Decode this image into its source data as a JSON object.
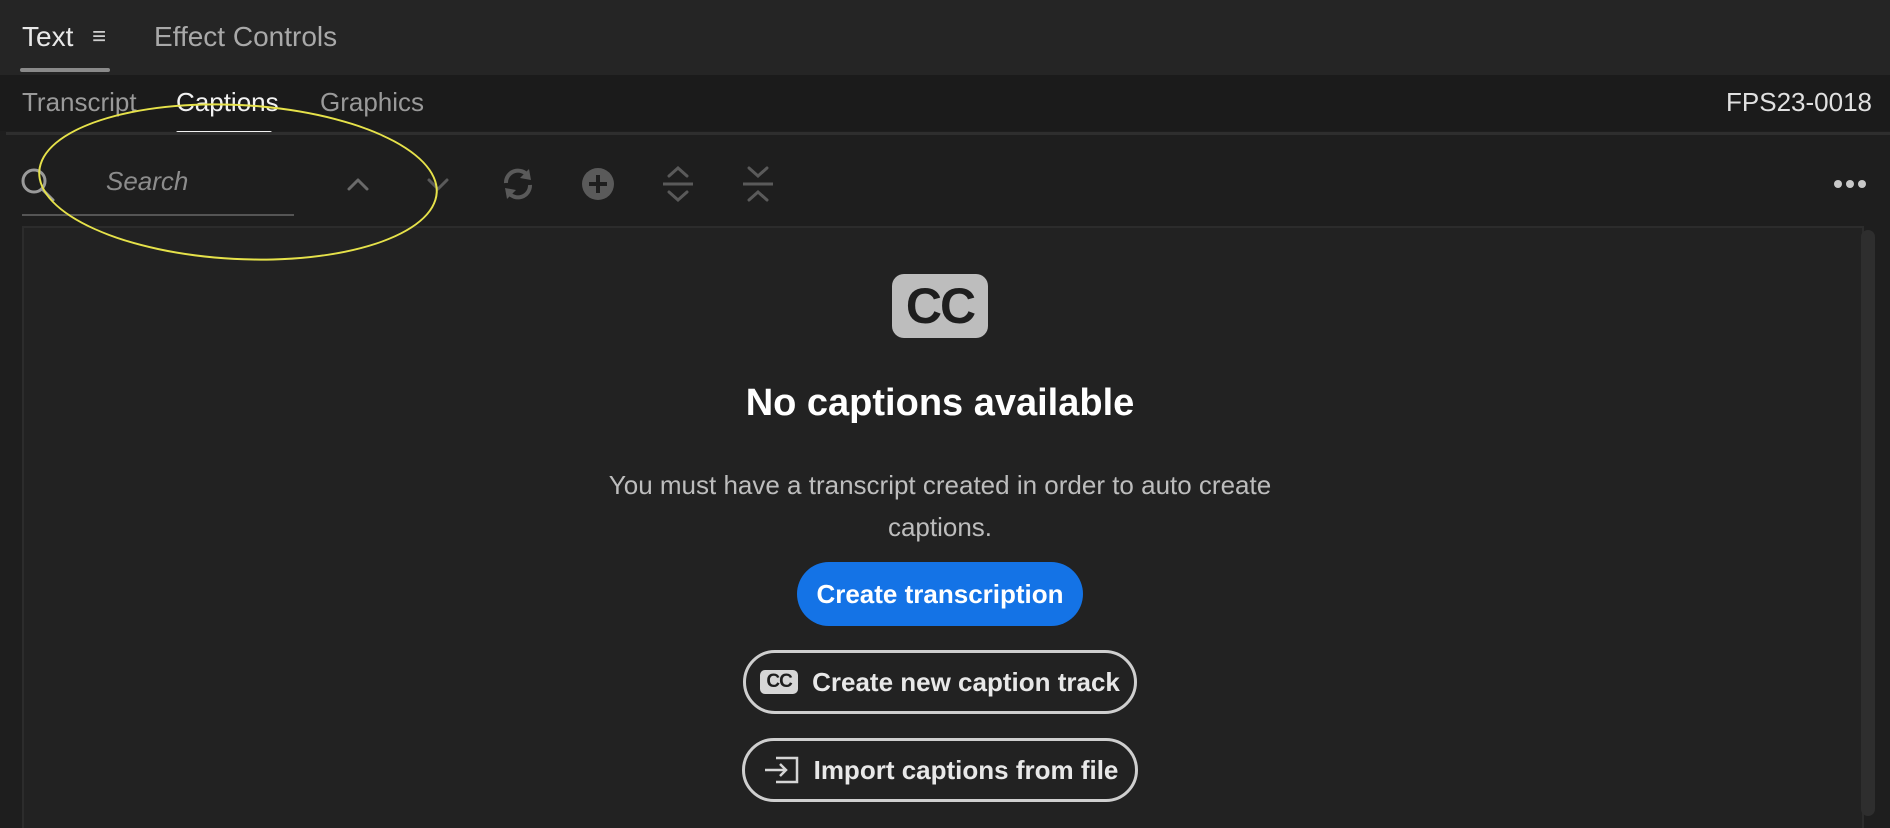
{
  "panel_tabs": {
    "text": "Text",
    "menu": "≡",
    "effect_controls": "Effect Controls"
  },
  "subtabs": {
    "transcript": "Transcript",
    "captions": "Captions",
    "graphics": "Graphics"
  },
  "sequence_name": "FPS23-0018",
  "search": {
    "placeholder": "Search"
  },
  "empty_state": {
    "badge": "CC",
    "title": "No captions available",
    "description": "You must have a transcript created in order to auto create captions.",
    "create_transcription": "Create transcription",
    "create_caption_track": "Create new caption track",
    "import_captions": "Import captions from file"
  },
  "colors": {
    "accent": "#1473e6",
    "annotation": "#e6e24a"
  }
}
